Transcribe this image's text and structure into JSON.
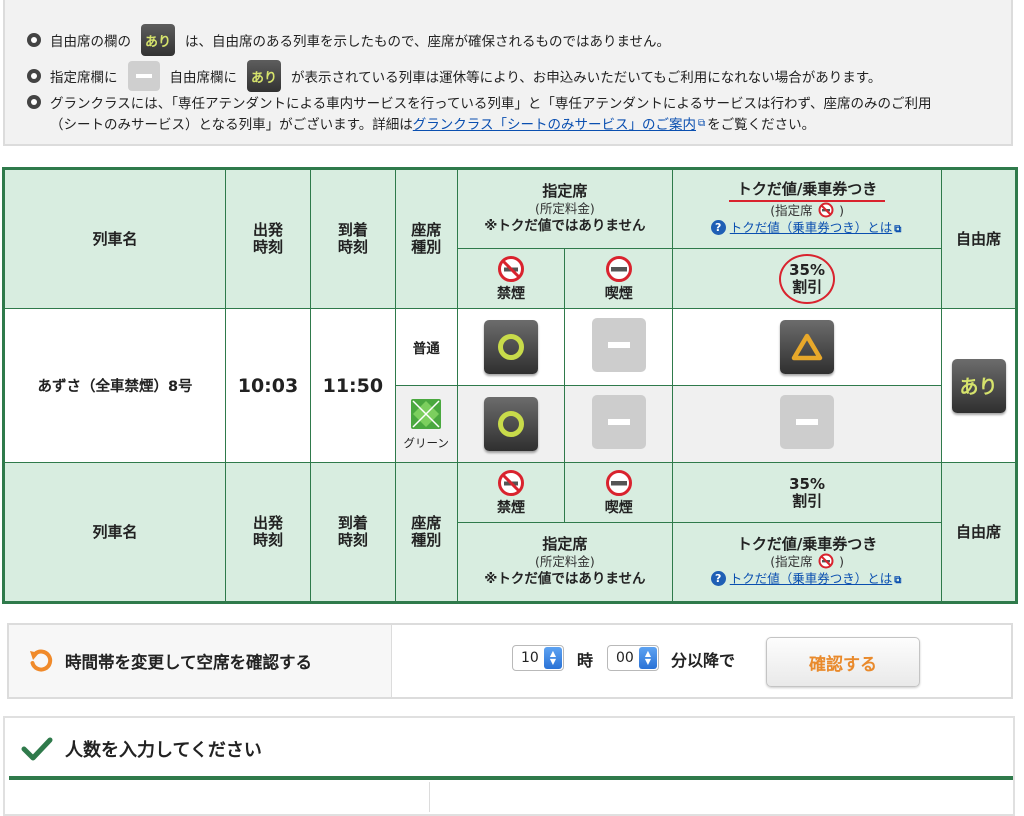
{
  "notes": {
    "line1_before": "自由席の欄の",
    "line1_badge": "あり",
    "line1_after": "は、自由席のある列車を示したもので、座席が確保されるものではありません。",
    "line2_a": "指定席欄に",
    "line2_b": "自由席欄に",
    "line2_badge": "あり",
    "line2_after": "が表示されている列車は運休等により、お申込みいただいてもご利用になれない場合があります。",
    "line3_1": "グランクラスには、「専任アテンダントによる車内サービスを行っている列車」と「専任アテンダントによるサービスは行わず、座席のみのご利用",
    "line3_2a": "（シートのみサービス）となる列車」がございます。詳細は",
    "line3_link": "グランクラス「シートのみサービス」のご案内",
    "line3_2b": "をご覧ください。"
  },
  "table": {
    "header": {
      "train_name": "列車名",
      "depart_1": "出発",
      "depart_2": "時刻",
      "arrive_1": "到着",
      "arrive_2": "時刻",
      "seat_1": "座席",
      "seat_2": "種別",
      "reserved_title": "指定席",
      "reserved_sub": "(所定料金)",
      "reserved_note": "※トクだ値ではありません",
      "tokuda_title": "トクだ値/乗車券つき",
      "tokuda_sub_before": "(指定席",
      "tokuda_sub_after": ")",
      "tokuda_link": "トクだ値（乗車券つき）とは",
      "unreserved": "自由席",
      "nonsmoking": "禁煙",
      "smoking": "喫煙",
      "discount_1": "35%",
      "discount_2": "割引"
    },
    "train": {
      "name": "あずさ（全車禁煙）8号",
      "depart": "10:03",
      "arrive": "11:50",
      "row_ordinary_label": "普通",
      "row_green_label": "グリーン",
      "unreserved_badge": "あり"
    }
  },
  "timebar": {
    "label": "時間帯を変更して空席を確認する",
    "hour_value": "10",
    "hour_unit": "時",
    "minute_value": "00",
    "minute_unit": "分以降で",
    "confirm_label": "確認する"
  },
  "passengers": {
    "title": "人数を入力してください"
  },
  "colors": {
    "table_border": "#2f7a4b",
    "header_bg": "#d8ede0",
    "accent_orange": "#e98a2c",
    "link_blue": "#0a4fb0",
    "ring_green": "#c8db4a",
    "red_mark": "#d9232e"
  }
}
